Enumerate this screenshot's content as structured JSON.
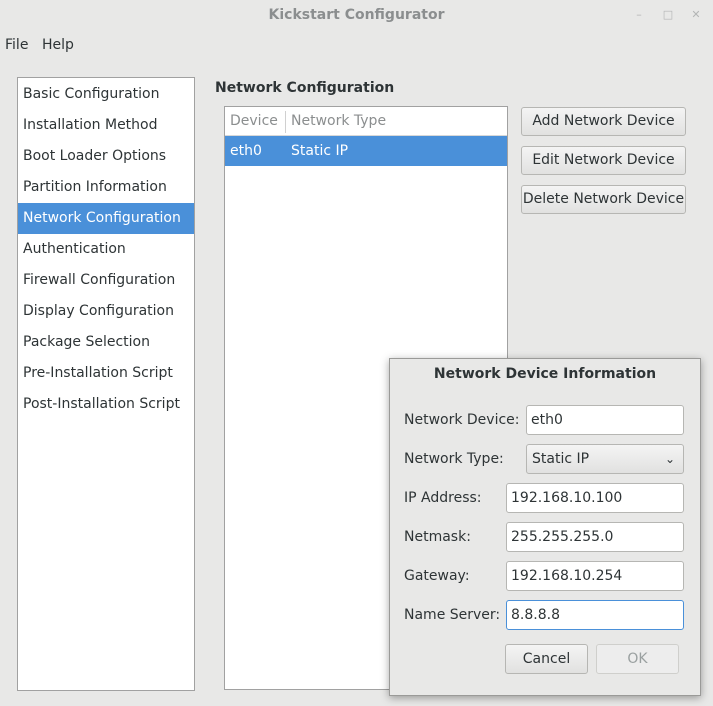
{
  "window": {
    "title": "Kickstart Configurator"
  },
  "menubar": {
    "items": [
      "File",
      "Help"
    ]
  },
  "sidebar": {
    "items": [
      {
        "label": "Basic Configuration",
        "selected": false
      },
      {
        "label": "Installation Method",
        "selected": false
      },
      {
        "label": "Boot Loader Options",
        "selected": false
      },
      {
        "label": "Partition Information",
        "selected": false
      },
      {
        "label": "Network Configuration",
        "selected": true
      },
      {
        "label": "Authentication",
        "selected": false
      },
      {
        "label": "Firewall Configuration",
        "selected": false
      },
      {
        "label": "Display Configuration",
        "selected": false
      },
      {
        "label": "Package Selection",
        "selected": false
      },
      {
        "label": "Pre-Installation Script",
        "selected": false
      },
      {
        "label": "Post-Installation Script",
        "selected": false
      }
    ]
  },
  "main": {
    "section_title": "Network Configuration",
    "table": {
      "columns": [
        "Device",
        "Network Type"
      ],
      "rows": [
        {
          "device": "eth0",
          "type": "Static IP"
        }
      ]
    },
    "buttons": {
      "add": "Add Network Device",
      "edit": "Edit Network Device",
      "delete": "Delete Network Device"
    }
  },
  "dialog": {
    "title": "Network Device Information",
    "device_label": "Network Device:",
    "device_value": "eth0",
    "type_label": "Network Type:",
    "type_value": "Static IP",
    "ip_label": "IP Address:",
    "ip_value": "192.168.10.100",
    "netmask_label": "Netmask:",
    "netmask_value": "255.255.255.0",
    "gateway_label": "Gateway:",
    "gateway_value": "192.168.10.254",
    "nameserver_label": "Name Server:",
    "nameserver_value": "8.8.8.8",
    "cancel_label": "Cancel",
    "ok_label": "OK"
  },
  "colors": {
    "selection": "#4a90d9",
    "window_bg": "#e8e8e7"
  }
}
